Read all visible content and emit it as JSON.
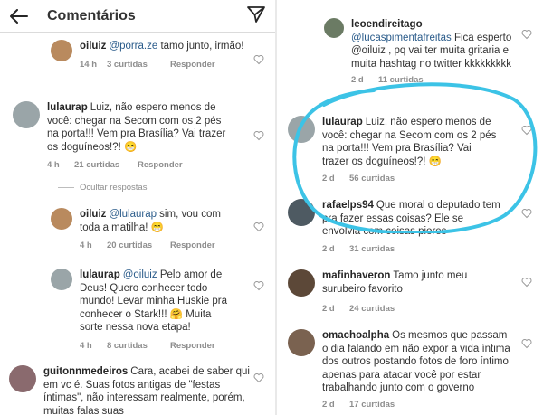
{
  "header": {
    "title": "Comentários"
  },
  "left": {
    "comments": [
      {
        "user": "oiluiz",
        "mention": "@porra.ze",
        "text": " tamo junto, irmão!",
        "time": "14 h",
        "likes": "3 curtidas",
        "reply": "Responder"
      },
      {
        "user": "lulaurap",
        "mention": "",
        "text": "Luiz, não espero menos de você: chegar na Secom com os 2 pés na porta!!! Vem pra Brasília? Vai trazer os doguíneos!?! 😁",
        "time": "4 h",
        "likes": "21 curtidas",
        "reply": "Responder"
      },
      {
        "user": "oiluiz",
        "mention": "@lulaurap",
        "text": " sim, vou com toda a matilha! 😁",
        "time": "4 h",
        "likes": "20 curtidas",
        "reply": "Responder"
      },
      {
        "user": "lulaurap",
        "mention": "@oiluiz",
        "text": " Pelo amor de Deus! Quero conhecer todo mundo! Levar minha Huskie pra conhecer o Stark!!! 🤗 Muita sorte nessa nova etapa!",
        "time": "4 h",
        "likes": "8 curtidas",
        "reply": "Responder"
      },
      {
        "user": "guitonnmedeiros",
        "mention": "",
        "text": "Cara, acabei de saber qui em vc é. Suas fotos antigas de \"festas íntimas\", não interessam realmente, porém, muitas falas suas",
        "time": "",
        "likes": "",
        "reply": ""
      }
    ],
    "hide_replies": "Ocultar respostas"
  },
  "right": {
    "comments": [
      {
        "user": "leoendireitago",
        "mention": "@lucaspimentafreitas",
        "text": " Fica esperto @oiluiz , pq vai ter muita gritaria e muita hashtag no twitter kkkkkkkkk",
        "time": "2 d",
        "likes": "11 curtidas"
      },
      {
        "user": "lulaurap",
        "mention": "",
        "text": "Luiz, não espero menos de você: chegar na Secom com os 2 pés na porta!!! Vem pra Brasília? Vai trazer os doguíneos!?! 😁",
        "time": "2 d",
        "likes": "56 curtidas"
      },
      {
        "user": "rafaelps94",
        "mention": "",
        "text": "Que moral o deputado tem pra fazer essas coisas? Ele se envolvia com coisas piores",
        "time": "2 d",
        "likes": "31 curtidas"
      },
      {
        "user": "mafinhaveron",
        "mention": "",
        "text": "Tamo junto meu surubeiro favorito",
        "time": "2 d",
        "likes": "24 curtidas"
      },
      {
        "user": "omachoalpha",
        "mention": "",
        "text": "Os mesmos que passam o dia falando em não expor a vida íntima dos outros postando fotos de foro íntimo apenas para atacar você por estar trabalhando junto com o governo",
        "time": "2 d",
        "likes": "17 curtidas"
      }
    ]
  },
  "colors": {
    "annotation": "#3cc3e6",
    "mention": "#2a5b8a",
    "meta": "#8e8e8e"
  },
  "icons": [
    "back-arrow-icon",
    "send-icon",
    "heart-icon"
  ]
}
